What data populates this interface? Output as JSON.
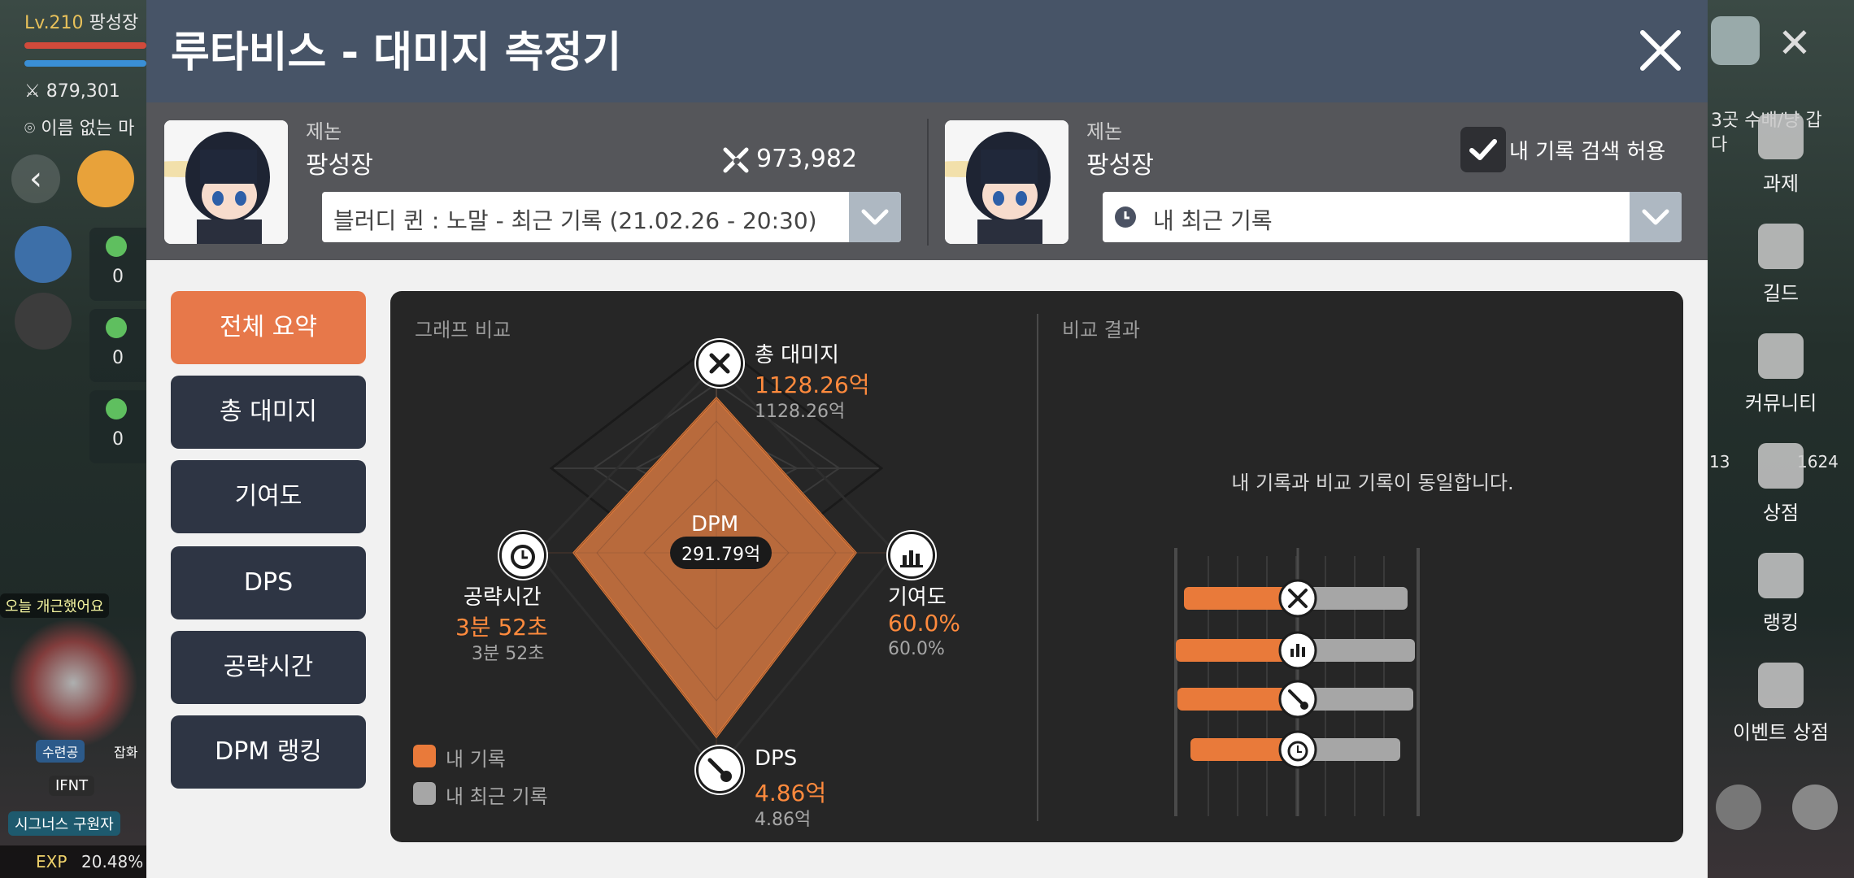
{
  "background": {
    "player_level": "Lv.210",
    "player_name": "팡성장",
    "power": "879,301",
    "location": "이름 없는 마",
    "left_counts": [
      "0",
      "0",
      "0"
    ],
    "chat_snippet": "오늘 개근했어요",
    "tag_label": "IFNT",
    "tag2": "수련공",
    "tag3": "잡화",
    "bottom_tag": "시그너스 구원자",
    "exp_label": "EXP",
    "exp_value": "20.48%",
    "right_text": "3곳 수배/냥 갑",
    "right_text2": "다",
    "right_nums": [
      "13",
      "1624"
    ],
    "right_menu": [
      {
        "label": "과제",
        "icon": "task-icon"
      },
      {
        "label": "길드",
        "icon": "guild-icon"
      },
      {
        "label": "커뮤니티",
        "icon": "community-icon"
      },
      {
        "label": "상점",
        "icon": "shop-icon"
      },
      {
        "label": "랭킹",
        "icon": "ranking-icon"
      },
      {
        "label": "이벤트 상점",
        "icon": "event-shop-icon"
      }
    ]
  },
  "dialog": {
    "title": "루타비스 - 대미지 측정기",
    "left_profile": {
      "job": "제논",
      "name": "팡성장",
      "power": "973,982",
      "record_select": "블러디 퀸 : 노말 - 최근 기록 (21.02.26 - 20:30)"
    },
    "right_profile": {
      "job": "제논",
      "name": "팡성장",
      "allow_search_label": "내 기록 검색 허용",
      "allow_search_checked": true,
      "record_select": "내 최근 기록"
    },
    "tabs": [
      "전체 요약",
      "총 대미지",
      "기여도",
      "DPS",
      "공략시간",
      "DPM 랭킹"
    ],
    "active_tab": 0,
    "graph_section_title": "그래프 비교",
    "result_section_title": "비교 결과",
    "result_message": "내 기록과 비교 기록이 동일합니다.",
    "center_label": "DPM",
    "center_value": "291.79억",
    "stats": {
      "total_damage": {
        "label": "총 대미지",
        "mine": "1128.26억",
        "other": "1128.26억"
      },
      "contribution": {
        "label": "기여도",
        "mine": "60.0%",
        "other": "60.0%"
      },
      "dps": {
        "label": "DPS",
        "mine": "4.86억",
        "other": "4.86억"
      },
      "clear_time": {
        "label": "공략시간",
        "mine": "3분 52초",
        "other": "3분 52초"
      }
    },
    "legend": [
      {
        "label": "내 기록",
        "color": "#e97a3a"
      },
      {
        "label": "내 최근 기록",
        "color": "#a6a6a6"
      }
    ],
    "colors": {
      "accent": "#e7784a",
      "mine": "#ff8a3d",
      "other": "#a6a6a6",
      "panel": "#262626",
      "tab": "#2e3544",
      "title_bar": "#475467"
    }
  }
}
